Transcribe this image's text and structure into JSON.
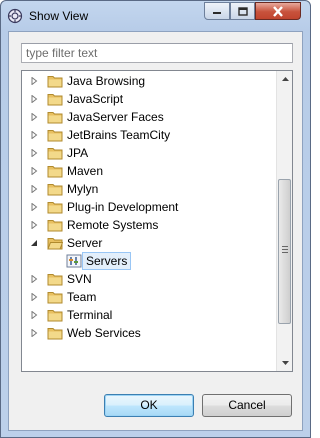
{
  "window": {
    "title": "Show View",
    "controls": {
      "minimize": "minimize",
      "maximize": "maximize",
      "close": "close"
    }
  },
  "filter": {
    "placeholder": "type filter text",
    "value": ""
  },
  "tree": {
    "items": [
      {
        "label": "Java Browsing",
        "level": 0,
        "expanded": false,
        "icon": "folder-icon"
      },
      {
        "label": "JavaScript",
        "level": 0,
        "expanded": false,
        "icon": "folder-icon"
      },
      {
        "label": "JavaServer Faces",
        "level": 0,
        "expanded": false,
        "icon": "folder-icon"
      },
      {
        "label": "JetBrains TeamCity",
        "level": 0,
        "expanded": false,
        "icon": "folder-icon"
      },
      {
        "label": "JPA",
        "level": 0,
        "expanded": false,
        "icon": "folder-icon"
      },
      {
        "label": "Maven",
        "level": 0,
        "expanded": false,
        "icon": "folder-icon"
      },
      {
        "label": "Mylyn",
        "level": 0,
        "expanded": false,
        "icon": "folder-icon"
      },
      {
        "label": "Plug-in Development",
        "level": 0,
        "expanded": false,
        "icon": "folder-icon"
      },
      {
        "label": "Remote Systems",
        "level": 0,
        "expanded": false,
        "icon": "folder-icon"
      },
      {
        "label": "Server",
        "level": 0,
        "expanded": true,
        "icon": "folder-open-icon"
      },
      {
        "label": "Servers",
        "level": 1,
        "selected": true,
        "icon": "servers-view-icon"
      },
      {
        "label": "SVN",
        "level": 0,
        "expanded": false,
        "icon": "folder-icon"
      },
      {
        "label": "Team",
        "level": 0,
        "expanded": false,
        "icon": "folder-icon"
      },
      {
        "label": "Terminal",
        "level": 0,
        "expanded": false,
        "icon": "folder-icon"
      },
      {
        "label": "Web Services",
        "level": 0,
        "expanded": false,
        "icon": "folder-icon"
      }
    ]
  },
  "buttons": {
    "ok": "OK",
    "cancel": "Cancel"
  },
  "colors": {
    "title_bar": "#c3d6ee",
    "selection": "#e3effb",
    "folder": "#e8c060"
  }
}
